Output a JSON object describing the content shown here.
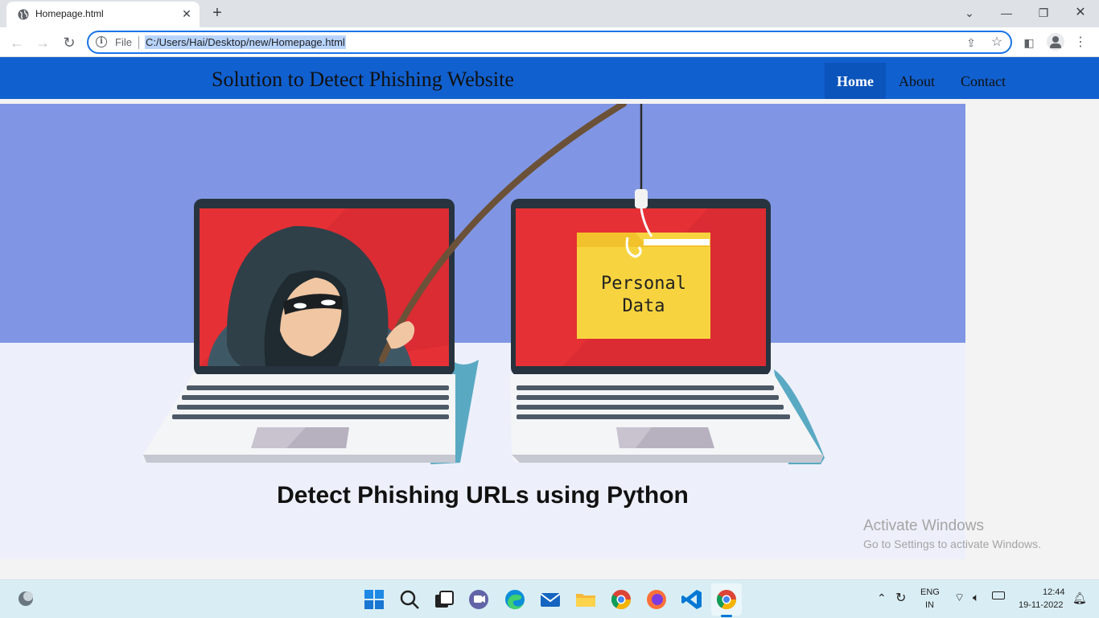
{
  "browser": {
    "tab_title": "Homepage.html",
    "url_scheme": "File",
    "url": "C:/Users/Hai/Desktop/new/Homepage.html"
  },
  "site": {
    "title": "Solution to Detect Phishing Website",
    "nav": [
      {
        "label": "Home",
        "active": true
      },
      {
        "label": "About",
        "active": false
      },
      {
        "label": "Contact",
        "active": false
      }
    ],
    "hero_caption": "Detect Phishing URLs using Python",
    "folder_text_line1": "Personal",
    "folder_text_line2": "Data"
  },
  "watermark": {
    "line1": "Activate Windows",
    "line2": "Go to Settings to activate Windows."
  },
  "taskbar": {
    "language": "ENG",
    "region": "IN",
    "time": "12:44",
    "date": "19-11-2022"
  },
  "colors": {
    "nav_bg": "#1160cf",
    "hero_sky": "#8096e4",
    "laptop_screen": "#e53035",
    "folder": "#f7d43f"
  }
}
